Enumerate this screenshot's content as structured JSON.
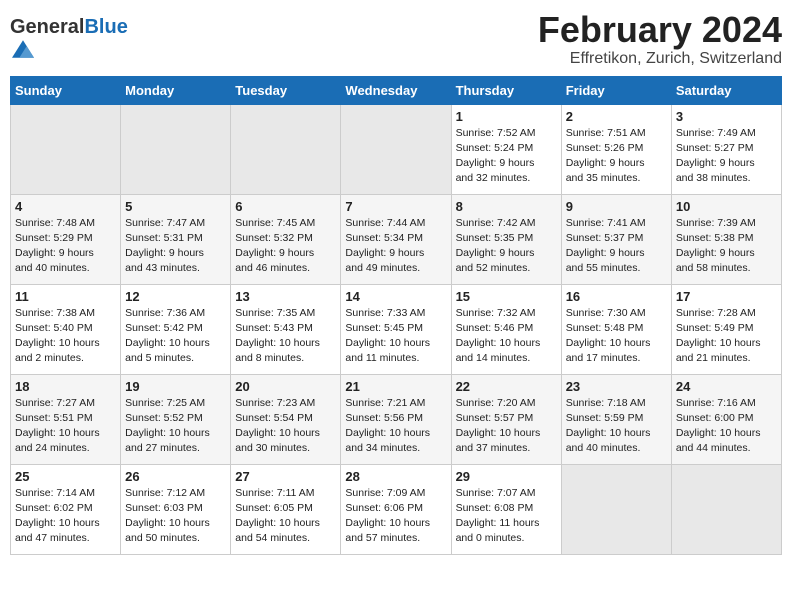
{
  "logo": {
    "general": "General",
    "blue": "Blue"
  },
  "title": "February 2024",
  "subtitle": "Effretikon, Zurich, Switzerland",
  "days_of_week": [
    "Sunday",
    "Monday",
    "Tuesday",
    "Wednesday",
    "Thursday",
    "Friday",
    "Saturday"
  ],
  "weeks": [
    [
      {
        "num": "",
        "info": ""
      },
      {
        "num": "",
        "info": ""
      },
      {
        "num": "",
        "info": ""
      },
      {
        "num": "",
        "info": ""
      },
      {
        "num": "1",
        "info": "Sunrise: 7:52 AM\nSunset: 5:24 PM\nDaylight: 9 hours\nand 32 minutes."
      },
      {
        "num": "2",
        "info": "Sunrise: 7:51 AM\nSunset: 5:26 PM\nDaylight: 9 hours\nand 35 minutes."
      },
      {
        "num": "3",
        "info": "Sunrise: 7:49 AM\nSunset: 5:27 PM\nDaylight: 9 hours\nand 38 minutes."
      }
    ],
    [
      {
        "num": "4",
        "info": "Sunrise: 7:48 AM\nSunset: 5:29 PM\nDaylight: 9 hours\nand 40 minutes."
      },
      {
        "num": "5",
        "info": "Sunrise: 7:47 AM\nSunset: 5:31 PM\nDaylight: 9 hours\nand 43 minutes."
      },
      {
        "num": "6",
        "info": "Sunrise: 7:45 AM\nSunset: 5:32 PM\nDaylight: 9 hours\nand 46 minutes."
      },
      {
        "num": "7",
        "info": "Sunrise: 7:44 AM\nSunset: 5:34 PM\nDaylight: 9 hours\nand 49 minutes."
      },
      {
        "num": "8",
        "info": "Sunrise: 7:42 AM\nSunset: 5:35 PM\nDaylight: 9 hours\nand 52 minutes."
      },
      {
        "num": "9",
        "info": "Sunrise: 7:41 AM\nSunset: 5:37 PM\nDaylight: 9 hours\nand 55 minutes."
      },
      {
        "num": "10",
        "info": "Sunrise: 7:39 AM\nSunset: 5:38 PM\nDaylight: 9 hours\nand 58 minutes."
      }
    ],
    [
      {
        "num": "11",
        "info": "Sunrise: 7:38 AM\nSunset: 5:40 PM\nDaylight: 10 hours\nand 2 minutes."
      },
      {
        "num": "12",
        "info": "Sunrise: 7:36 AM\nSunset: 5:42 PM\nDaylight: 10 hours\nand 5 minutes."
      },
      {
        "num": "13",
        "info": "Sunrise: 7:35 AM\nSunset: 5:43 PM\nDaylight: 10 hours\nand 8 minutes."
      },
      {
        "num": "14",
        "info": "Sunrise: 7:33 AM\nSunset: 5:45 PM\nDaylight: 10 hours\nand 11 minutes."
      },
      {
        "num": "15",
        "info": "Sunrise: 7:32 AM\nSunset: 5:46 PM\nDaylight: 10 hours\nand 14 minutes."
      },
      {
        "num": "16",
        "info": "Sunrise: 7:30 AM\nSunset: 5:48 PM\nDaylight: 10 hours\nand 17 minutes."
      },
      {
        "num": "17",
        "info": "Sunrise: 7:28 AM\nSunset: 5:49 PM\nDaylight: 10 hours\nand 21 minutes."
      }
    ],
    [
      {
        "num": "18",
        "info": "Sunrise: 7:27 AM\nSunset: 5:51 PM\nDaylight: 10 hours\nand 24 minutes."
      },
      {
        "num": "19",
        "info": "Sunrise: 7:25 AM\nSunset: 5:52 PM\nDaylight: 10 hours\nand 27 minutes."
      },
      {
        "num": "20",
        "info": "Sunrise: 7:23 AM\nSunset: 5:54 PM\nDaylight: 10 hours\nand 30 minutes."
      },
      {
        "num": "21",
        "info": "Sunrise: 7:21 AM\nSunset: 5:56 PM\nDaylight: 10 hours\nand 34 minutes."
      },
      {
        "num": "22",
        "info": "Sunrise: 7:20 AM\nSunset: 5:57 PM\nDaylight: 10 hours\nand 37 minutes."
      },
      {
        "num": "23",
        "info": "Sunrise: 7:18 AM\nSunset: 5:59 PM\nDaylight: 10 hours\nand 40 minutes."
      },
      {
        "num": "24",
        "info": "Sunrise: 7:16 AM\nSunset: 6:00 PM\nDaylight: 10 hours\nand 44 minutes."
      }
    ],
    [
      {
        "num": "25",
        "info": "Sunrise: 7:14 AM\nSunset: 6:02 PM\nDaylight: 10 hours\nand 47 minutes."
      },
      {
        "num": "26",
        "info": "Sunrise: 7:12 AM\nSunset: 6:03 PM\nDaylight: 10 hours\nand 50 minutes."
      },
      {
        "num": "27",
        "info": "Sunrise: 7:11 AM\nSunset: 6:05 PM\nDaylight: 10 hours\nand 54 minutes."
      },
      {
        "num": "28",
        "info": "Sunrise: 7:09 AM\nSunset: 6:06 PM\nDaylight: 10 hours\nand 57 minutes."
      },
      {
        "num": "29",
        "info": "Sunrise: 7:07 AM\nSunset: 6:08 PM\nDaylight: 11 hours\nand 0 minutes."
      },
      {
        "num": "",
        "info": ""
      },
      {
        "num": "",
        "info": ""
      }
    ]
  ]
}
